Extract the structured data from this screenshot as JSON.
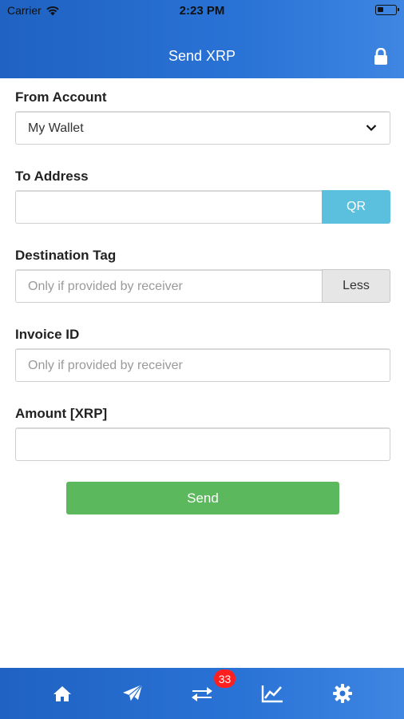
{
  "status_bar": {
    "carrier": "Carrier",
    "time": "2:23 PM"
  },
  "nav": {
    "title": "Send XRP",
    "lock_icon": "lock-icon"
  },
  "form": {
    "from_account": {
      "label": "From Account",
      "value": "My Wallet"
    },
    "to_address": {
      "label": "To Address",
      "value": "",
      "qr_label": "QR"
    },
    "destination_tag": {
      "label": "Destination Tag",
      "placeholder": "Only if provided by receiver",
      "less_label": "Less"
    },
    "invoice_id": {
      "label": "Invoice ID",
      "placeholder": "Only if provided by receiver"
    },
    "amount": {
      "label": "Amount [XRP]",
      "value": ""
    },
    "send_label": "Send"
  },
  "tabbar": {
    "items": [
      {
        "icon": "home-icon"
      },
      {
        "icon": "paper-plane-icon"
      },
      {
        "icon": "exchange-icon",
        "badge": "33"
      },
      {
        "icon": "chart-icon"
      },
      {
        "icon": "gear-icon"
      }
    ]
  },
  "colors": {
    "header": "#2a73d6",
    "qr": "#5bc0de",
    "send": "#5cb85c",
    "badge": "#ff1f1f"
  }
}
